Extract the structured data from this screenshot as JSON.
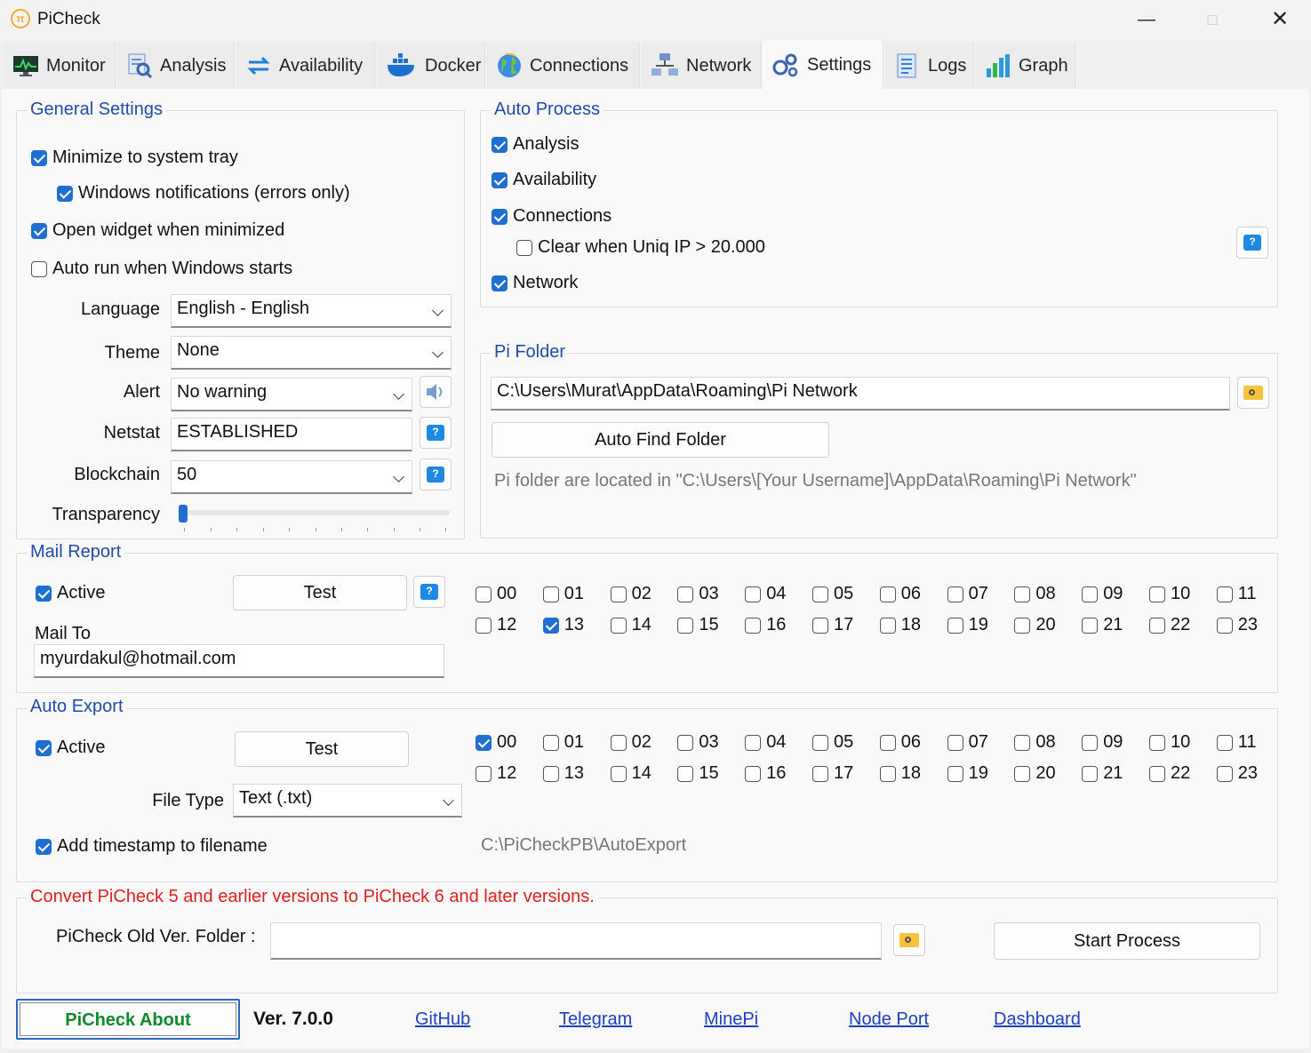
{
  "window": {
    "title": "PiCheck"
  },
  "tabs": [
    {
      "label": "Monitor"
    },
    {
      "label": "Analysis"
    },
    {
      "label": "Availability"
    },
    {
      "label": "Docker"
    },
    {
      "label": "Connections"
    },
    {
      "label": "Network"
    },
    {
      "label": "Settings"
    },
    {
      "label": "Logs"
    },
    {
      "label": "Graph"
    }
  ],
  "general": {
    "legend": "General Settings",
    "minimize_tray": {
      "label": "Minimize to system tray",
      "checked": true
    },
    "win_notif": {
      "label": "Windows notifications (errors only)",
      "checked": true
    },
    "open_widget": {
      "label": "Open widget when minimized",
      "checked": true
    },
    "auto_run": {
      "label": "Auto run when Windows starts",
      "checked": false
    },
    "language": {
      "label": "Language",
      "value": "English - English"
    },
    "theme": {
      "label": "Theme",
      "value": "None"
    },
    "alert": {
      "label": "Alert",
      "value": "No warning"
    },
    "netstat": {
      "label": "Netstat",
      "value": "ESTABLISHED"
    },
    "blockchain": {
      "label": "Blockchain",
      "value": "50"
    },
    "transparency": {
      "label": "Transparency",
      "value": 0
    }
  },
  "auto_process": {
    "legend": "Auto Process",
    "analysis": {
      "label": "Analysis",
      "checked": true
    },
    "availability": {
      "label": "Availability",
      "checked": true
    },
    "connections": {
      "label": "Connections",
      "checked": true
    },
    "clear": {
      "label": "Clear when Uniq IP > 20.000",
      "checked": false
    },
    "network": {
      "label": "Network",
      "checked": true
    }
  },
  "pi_folder": {
    "legend": "Pi Folder",
    "path": "C:\\Users\\Murat\\AppData\\Roaming\\Pi Network",
    "auto_find": "Auto Find Folder",
    "hint": "Pi folder are located in \"C:\\Users\\[Your Username]\\AppData\\Roaming\\Pi Network\""
  },
  "mail_report": {
    "legend": "Mail Report",
    "active": {
      "label": "Active",
      "checked": true
    },
    "test": "Test",
    "mail_to_label": "Mail To",
    "mail_to": "myurdakul@hotmail.com",
    "hours_checked": [
      "13"
    ]
  },
  "auto_export": {
    "legend": "Auto Export",
    "active": {
      "label": "Active",
      "checked": true
    },
    "test": "Test",
    "file_type_label": "File Type",
    "file_type": "Text (.txt)",
    "timestamp": {
      "label": "Add timestamp to filename",
      "checked": true
    },
    "path": "C:\\PiCheckPB\\AutoExport",
    "hours_checked": [
      "00"
    ]
  },
  "hours": [
    "00",
    "01",
    "02",
    "03",
    "04",
    "05",
    "06",
    "07",
    "08",
    "09",
    "10",
    "11",
    "12",
    "13",
    "14",
    "15",
    "16",
    "17",
    "18",
    "19",
    "20",
    "21",
    "22",
    "23"
  ],
  "convert": {
    "legend": "Convert PiCheck 5 and earlier versions to PiCheck 6 and later versions.",
    "folder_label": "PiCheck Old Ver. Folder :",
    "folder_value": "",
    "start": "Start Process"
  },
  "footer": {
    "about": "PiCheck About",
    "version": "Ver. 7.0.0",
    "links": [
      "GitHub",
      "Telegram",
      "MinePi",
      "Node Port",
      "Dashboard"
    ]
  },
  "colors": {
    "accent": "#1f6fd1",
    "legend": "#2349a8",
    "warning": "#e02020",
    "about_text": "#0e8a2a"
  }
}
